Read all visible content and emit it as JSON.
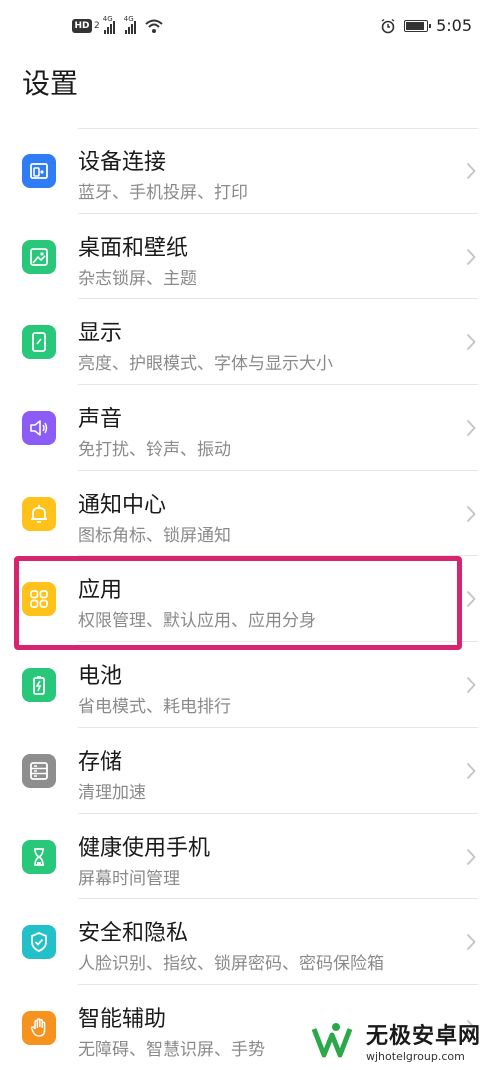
{
  "status_bar": {
    "hd_label": "HD",
    "hd_sub": "2",
    "network_1": "4G",
    "network_2": "4G",
    "time": "5:05",
    "icons": [
      "alarm-icon",
      "battery-icon",
      "wifi-icon",
      "signal-icon"
    ]
  },
  "page": {
    "title": "设置"
  },
  "settings": [
    {
      "title": "设备连接",
      "subtitle": "蓝牙、手机投屏、打印",
      "icon": "device-connection-icon",
      "color": "#2f7cf6"
    },
    {
      "title": "桌面和壁纸",
      "subtitle": "杂志锁屏、主题",
      "icon": "wallpaper-icon",
      "color": "#28c77a"
    },
    {
      "title": "显示",
      "subtitle": "亮度、护眼模式、字体与显示大小",
      "icon": "display-icon",
      "color": "#28c77a"
    },
    {
      "title": "声音",
      "subtitle": "免打扰、铃声、振动",
      "icon": "sound-icon",
      "color": "#8b5cf6"
    },
    {
      "title": "通知中心",
      "subtitle": "图标角标、锁屏通知",
      "icon": "notification-icon",
      "color": "#ffc21a"
    },
    {
      "title": "应用",
      "subtitle": "权限管理、默认应用、应用分身",
      "icon": "apps-icon",
      "color": "#ffc21a"
    },
    {
      "title": "电池",
      "subtitle": "省电模式、耗电排行",
      "icon": "battery-icon",
      "color": "#28c77a"
    },
    {
      "title": "存储",
      "subtitle": "清理加速",
      "icon": "storage-icon",
      "color": "#8e8e8e"
    },
    {
      "title": "健康使用手机",
      "subtitle": "屏幕时间管理",
      "icon": "hourglass-icon",
      "color": "#28c77a"
    },
    {
      "title": "安全和隐私",
      "subtitle": "人脸识别、指纹、锁屏密码、密码保险箱",
      "icon": "shield-icon",
      "color": "#22c0c9"
    },
    {
      "title": "智能辅助",
      "subtitle": "无障碍、智慧识屏、手势",
      "icon": "hand-icon",
      "color": "#f6921e"
    }
  ],
  "highlight": {
    "item": "应用",
    "color": "#d6246e"
  },
  "watermark": {
    "name": "无极安卓网",
    "url": "wjhotelgroup.com"
  }
}
